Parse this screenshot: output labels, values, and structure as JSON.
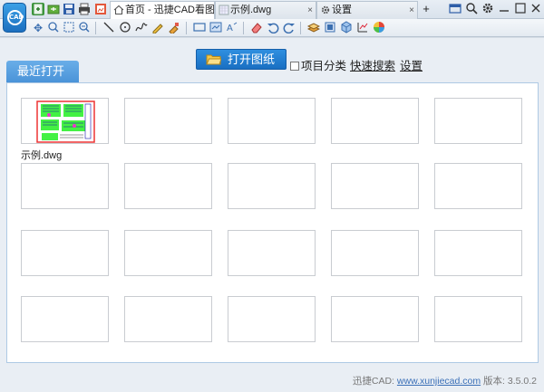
{
  "app": {
    "logo_text": "CAD"
  },
  "tabs": [
    {
      "label": "首页 - 迅捷CAD看图",
      "close": "×"
    },
    {
      "label": "示例.dwg",
      "close": "×"
    },
    {
      "label": "设置",
      "close": "×"
    }
  ],
  "titlebar": {
    "new_tab": "+"
  },
  "toolbar_icons": [
    "pan-icon",
    "zoom-window-icon",
    "zoom-extents-icon",
    "zoom-prev-icon",
    "line-icon",
    "circle-icon",
    "polyline-icon",
    "text-edit-icon",
    "cloud-markup-icon",
    "rect-measure-icon",
    "area-icon",
    "text-icon",
    "eraser-icon",
    "undo-icon",
    "redo-icon",
    "layers-icon",
    "layout-icon",
    "3d-view-icon",
    "plot-icon",
    "color-wheel-icon"
  ],
  "main": {
    "recent_tab_label": "最近打开",
    "open_button_label": "打开图纸",
    "group_by_project_label": "项目分类",
    "quick_search_label": "快速搜索",
    "settings_label": "设置"
  },
  "recent_files": [
    {
      "name": "示例.dwg"
    }
  ],
  "footer": {
    "prefix": "迅捷CAD: ",
    "url": "www.xunjiecad.com",
    "version_label": " 版本: ",
    "version": "3.5.0.2"
  },
  "colors": {
    "accent": "#1a6fc2",
    "recent_tab": "#4a93d8",
    "panel_border": "#aec9e4"
  }
}
